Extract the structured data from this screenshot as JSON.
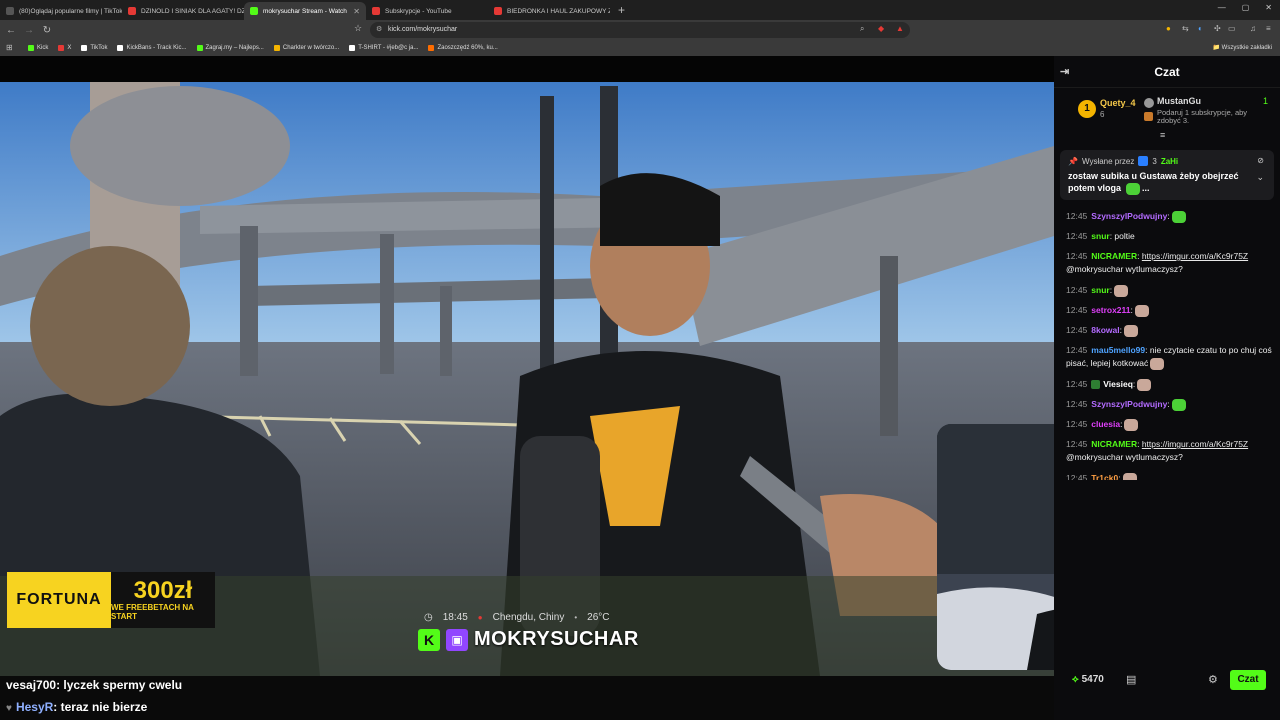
{
  "tabs": [
    {
      "title": "(80)Oglądaj popularne filmy | TikTok",
      "color": "#555555"
    },
    {
      "title": "DZINOLD I SINIAK DLA AGATY! DZIN",
      "color": "#e53935"
    },
    {
      "title": "mokrysuchar Stream - Watch",
      "color": "#53fc18"
    },
    {
      "title": "Subskrypcje - YouTube",
      "color": "#e53935"
    },
    {
      "title": "BIEDRONKA I HAUL ZAKUPOWY Z SI",
      "color": "#e53935"
    }
  ],
  "browser": {
    "url": "kick.com/mokrysuchar",
    "all_bookmarks": "Wszystkie zakładki",
    "bookmarks": [
      "Kick",
      "X",
      "TikTok",
      "KickBans - Track Kic...",
      "Zagraj.my – Najleps...",
      "Charkter w twórczo...",
      "T-SHIRT - #jeb@c ja...",
      "Zaoszczędź 60%, ku..."
    ]
  },
  "video": {
    "ad_brand": "FORTUNA",
    "ad_amount": "300zł",
    "ad_sub": "WE FREEBETACH NA START",
    "time": "18:45",
    "location": "Chengdu, Chiny",
    "temp": "26°C",
    "streamer": "MOKRYSUCHAR"
  },
  "overlay_chat": [
    {
      "nick": "vesaj700",
      "text": ": lyczek spermy cwelu"
    },
    {
      "nick": "HesyR",
      "text": ": teraz nie bierze"
    }
  ],
  "chat": {
    "title": "Czat",
    "leader1_rank": "1",
    "leader1_name": "Quety_4",
    "leader1_count": "6",
    "leader2_name": "MustanGu",
    "leader2_count": "1",
    "leader2_hint": "Podaruj 1 subskrypcje, aby zdobyć 3.",
    "pinned_by_label": "Wysłane przez",
    "pinned_badge_num": "3",
    "pinned_user": "ZaHi",
    "pinned_text": "zostaw subika u Gustawa żeby obejrzeć potem vloga",
    "pinned_suffix": "...",
    "messages": [
      {
        "time": "12:45",
        "user": "SzynszylPodwujny",
        "color": "#b36bff",
        "text": ":",
        "emote": "green",
        "link": ""
      },
      {
        "time": "12:45",
        "user": "snur",
        "color": "#53fc18",
        "text": ": poltie",
        "emote": "",
        "link": ""
      },
      {
        "time": "12:45",
        "user": "NICRAMER",
        "color": "#53fc18",
        "text": ": ",
        "emote": "",
        "link": "https://imgur.com/a/Kc9r75Z",
        "after": "@mokrysuchar wytlumaczysz?"
      },
      {
        "time": "12:45",
        "user": "snur",
        "color": "#53fc18",
        "text": ":",
        "emote": "cat",
        "link": ""
      },
      {
        "time": "12:45",
        "user": "setrox211",
        "color": "#e040fb",
        "text": ":",
        "emote": "cat",
        "link": ""
      },
      {
        "time": "12:45",
        "user": "8kowal",
        "color": "#b36bff",
        "text": ":",
        "emote": "cat",
        "link": ""
      },
      {
        "time": "12:45",
        "user": "mau5mello99",
        "color": "#4fa3ff",
        "text": ": nie czytacie czatu to po chuj coś pisać, lepiej kotkować",
        "emote": "cat",
        "link": ""
      },
      {
        "time": "12:45",
        "user": "Viesieq",
        "color": "#ffffff",
        "text": ":",
        "emote": "cat",
        "link": "",
        "badge": true
      },
      {
        "time": "12:45",
        "user": "SzynszylPodwujny",
        "color": "#b36bff",
        "text": ":",
        "emote": "green",
        "link": ""
      },
      {
        "time": "12:45",
        "user": "cluesia",
        "color": "#e040fb",
        "text": ":",
        "emote": "cat",
        "link": ""
      },
      {
        "time": "12:45",
        "user": "NICRAMER",
        "color": "#53fc18",
        "text": ": ",
        "emote": "",
        "link": "https://imgur.com/a/Kc9r75Z",
        "after": "@mokrysuchar wytlumaczysz?"
      },
      {
        "time": "12:45",
        "user": "Tr1ck0",
        "color": "#ff9f43",
        "text": ":",
        "emote": "cat",
        "link": ""
      }
    ],
    "points": "5470",
    "chat_button": "Czat"
  }
}
